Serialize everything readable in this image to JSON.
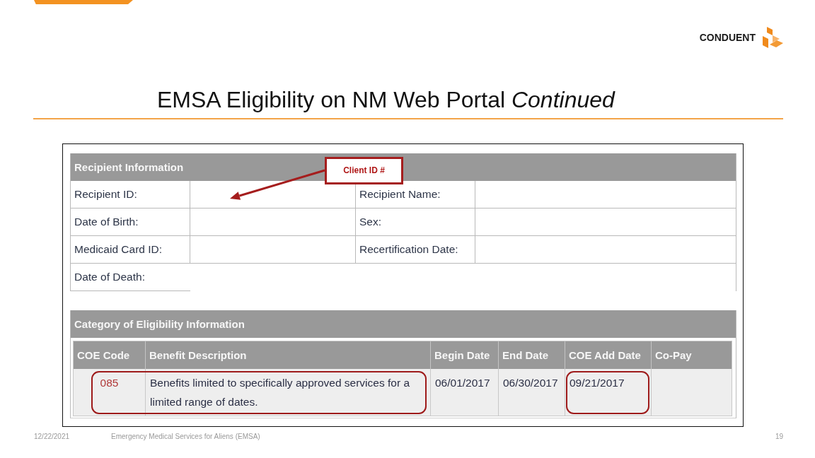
{
  "logo": {
    "text": "CONDUENT"
  },
  "title": "EMSA Eligibility on NM Web Portal *Continued*",
  "recipient_information": {
    "title": "Recipient Information",
    "rows": [
      {
        "fields": [
          {
            "label": "Recipient ID:"
          },
          {
            "label": "Recipient Name:"
          }
        ]
      },
      {
        "fields": [
          {
            "label": "Date of Birth:"
          },
          {
            "label": "Sex:"
          }
        ]
      },
      {
        "fields": [
          {
            "label": "Medicaid Card ID:"
          },
          {
            "label": "Recertification Date:"
          }
        ]
      },
      {
        "fields": [
          {
            "label": "Date of Death:"
          }
        ]
      }
    ],
    "callout": {
      "text": "Client ID #"
    }
  },
  "category_of_eligibility": {
    "title": "Category of Eligibility Information",
    "columns": [
      "COE Code",
      "Benefit Description",
      "Begin Date",
      "End Date",
      "COE Add Date",
      "Co-Pay"
    ],
    "rows": [
      {
        "cells": [
          {
            "text": "085",
            "kind": "code",
            "circled": true
          },
          {
            "text": "Benefits limited to specifically approved services for a limited range of dates.",
            "kind": "text",
            "circled": true
          },
          {
            "text": "06/01/2017",
            "kind": "text",
            "circled": false
          },
          {
            "text": "06/30/2017",
            "kind": "text",
            "circled": false
          },
          {
            "text": "09/21/2017",
            "kind": "text",
            "circled": true
          }
        ]
      }
    ]
  },
  "footer": {
    "date": "12/22/2021",
    "text": "Emergency Medical Services for Aliens (EMSA)",
    "page": "19"
  }
}
